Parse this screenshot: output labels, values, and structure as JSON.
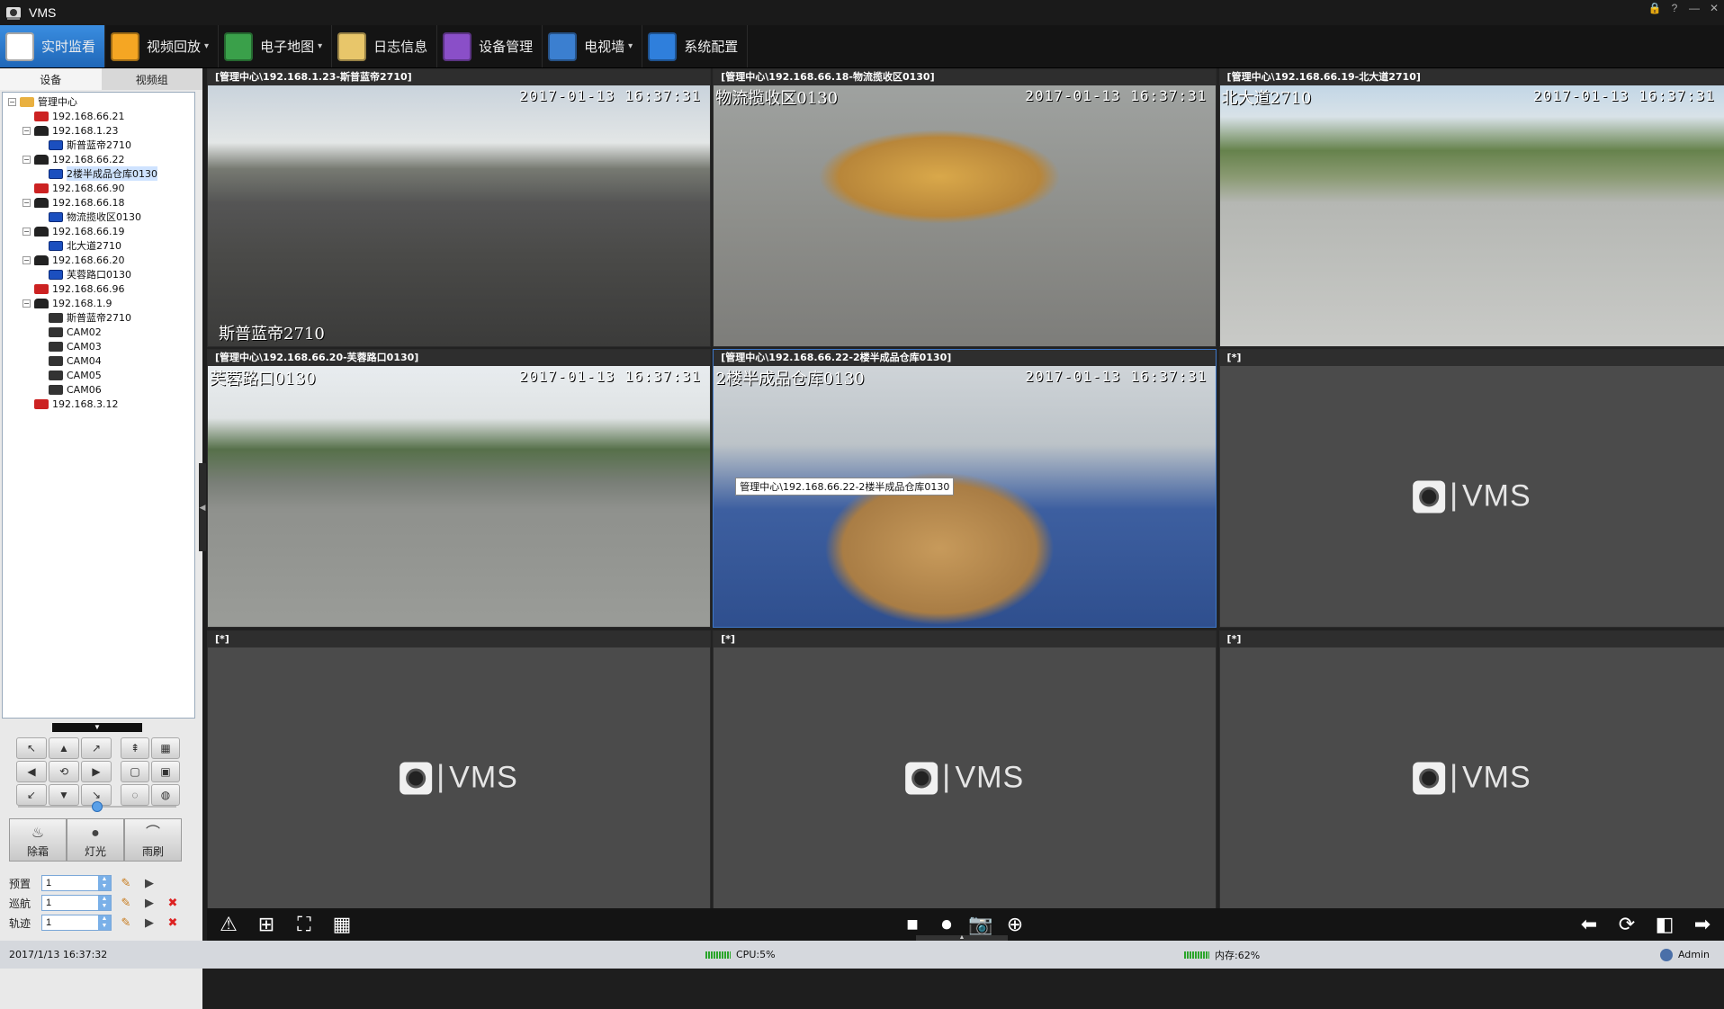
{
  "window": {
    "title": "VMS",
    "controls": [
      "🔒",
      "?",
      "—",
      "✕"
    ]
  },
  "menu": [
    {
      "label": "实时监看",
      "icon": "live-view-icon",
      "active": true,
      "caret": false,
      "color": "#ffffff"
    },
    {
      "label": "视频回放",
      "icon": "playback-icon",
      "active": false,
      "caret": true,
      "color": "#f5a623"
    },
    {
      "label": "电子地图",
      "icon": "emap-icon",
      "active": false,
      "caret": true,
      "color": "#3aa04a"
    },
    {
      "label": "日志信息",
      "icon": "log-icon",
      "active": false,
      "caret": false,
      "color": "#e8c66a"
    },
    {
      "label": "设备管理",
      "icon": "device-mgmt-icon",
      "active": false,
      "caret": false,
      "color": "#8a4fc8"
    },
    {
      "label": "电视墙",
      "icon": "tv-wall-icon",
      "active": false,
      "caret": true,
      "color": "#3b7fd0"
    },
    {
      "label": "系统配置",
      "icon": "settings-gear-icon",
      "active": false,
      "caret": false,
      "color": "#2f7fdc"
    }
  ],
  "left_tabs": [
    "设备",
    "视频组"
  ],
  "tree": [
    {
      "level": 0,
      "exp": "−",
      "icon": "root",
      "label": "管理中心"
    },
    {
      "level": 1,
      "exp": "",
      "icon": "off",
      "label": "192.168.66.21"
    },
    {
      "level": 1,
      "exp": "−",
      "icon": "nvr",
      "label": "192.168.1.23"
    },
    {
      "level": 2,
      "exp": "",
      "icon": "ipc",
      "label": "斯普蓝帝2710"
    },
    {
      "level": 1,
      "exp": "−",
      "icon": "nvr",
      "label": "192.168.66.22"
    },
    {
      "level": 2,
      "exp": "",
      "icon": "ipc",
      "label": "2楼半成品仓库0130",
      "selected": true
    },
    {
      "level": 1,
      "exp": "",
      "icon": "off",
      "label": "192.168.66.90"
    },
    {
      "level": 1,
      "exp": "−",
      "icon": "nvr",
      "label": "192.168.66.18"
    },
    {
      "level": 2,
      "exp": "",
      "icon": "ipc",
      "label": "物流揽收区0130"
    },
    {
      "level": 1,
      "exp": "−",
      "icon": "nvr",
      "label": "192.168.66.19"
    },
    {
      "level": 2,
      "exp": "",
      "icon": "ipc",
      "label": "北大道2710"
    },
    {
      "level": 1,
      "exp": "−",
      "icon": "nvr",
      "label": "192.168.66.20"
    },
    {
      "level": 2,
      "exp": "",
      "icon": "ipc",
      "label": "芙蓉路口0130"
    },
    {
      "level": 1,
      "exp": "",
      "icon": "off",
      "label": "192.168.66.96"
    },
    {
      "level": 1,
      "exp": "−",
      "icon": "nvr",
      "label": "192.168.1.9"
    },
    {
      "level": 2,
      "exp": "",
      "icon": "cam",
      "label": "斯普蓝帝2710"
    },
    {
      "level": 2,
      "exp": "",
      "icon": "cam",
      "label": "CAM02"
    },
    {
      "level": 2,
      "exp": "",
      "icon": "cam",
      "label": "CAM03"
    },
    {
      "level": 2,
      "exp": "",
      "icon": "cam",
      "label": "CAM04"
    },
    {
      "level": 2,
      "exp": "",
      "icon": "cam",
      "label": "CAM05"
    },
    {
      "level": 2,
      "exp": "",
      "icon": "cam",
      "label": "CAM06"
    },
    {
      "level": 1,
      "exp": "",
      "icon": "off",
      "label": "192.168.3.12"
    }
  ],
  "ptz": {
    "collapse": "▼",
    "directions": [
      "↖",
      "▲",
      "↗",
      "◀",
      "⟲",
      "▶",
      "↙",
      "▼",
      "↘"
    ],
    "zoom_buttons": [
      "⇞",
      "▦",
      "▢",
      "▣",
      "◌",
      "◍"
    ],
    "speed_level": 0.5,
    "functions": [
      {
        "label": "除霜",
        "icon": "defrost-icon",
        "glyph": "♨"
      },
      {
        "label": "灯光",
        "icon": "light-icon",
        "glyph": "●"
      },
      {
        "label": "雨刷",
        "icon": "wiper-icon",
        "glyph": "⌒"
      }
    ],
    "rows": [
      {
        "label": "预置",
        "value": "1",
        "actions": [
          "edit",
          "play"
        ]
      },
      {
        "label": "巡航",
        "value": "1",
        "actions": [
          "edit",
          "play",
          "del"
        ]
      },
      {
        "label": "轨迹",
        "value": "1",
        "actions": [
          "edit",
          "play",
          "del"
        ]
      }
    ]
  },
  "cells": [
    {
      "header": "[管理中心\\192.168.1.23-斯普蓝帝2710]",
      "time": "2017-01-13 16:37:31",
      "osd": "斯普蓝帝2710",
      "osd_pos": "bottom",
      "scene": "road1"
    },
    {
      "header": "[管理中心\\192.168.66.18-物流揽收区0130]",
      "time": "2017-01-13 16:37:31",
      "osd": "物流揽收区0130",
      "osd_pos": "top",
      "scene": "boxes"
    },
    {
      "header": "[管理中心\\192.168.66.19-北大道2710]",
      "time": "2017-01-13 16:37:31",
      "osd": "北大道2710",
      "osd_pos": "top",
      "scene": "road2"
    },
    {
      "header": "[管理中心\\192.168.66.20-芙蓉路口0130]",
      "time": "2017-01-13 16:37:31",
      "osd": "芙蓉路口0130",
      "osd_pos": "top",
      "scene": "road3"
    },
    {
      "header": "[管理中心\\192.168.66.22-2楼半成品仓库0130]",
      "time": "2017-01-13 16:37:31",
      "osd": "2楼半成品仓库0130",
      "osd_pos": "top",
      "scene": "warehouse",
      "focus": true,
      "tooltip": "管理中心\\192.168.66.22-2楼半成品仓库0130"
    },
    {
      "header": "[*]",
      "empty": true
    },
    {
      "header": "[*]",
      "empty": true
    },
    {
      "header": "[*]",
      "empty": true
    },
    {
      "header": "[*]",
      "empty": true
    }
  ],
  "placeholder_logo": "VMS",
  "toolbar": {
    "left": [
      {
        "name": "alarm-icon",
        "glyph": "⚠"
      },
      {
        "name": "layout-split-icon",
        "glyph": "⊞"
      },
      {
        "name": "fullscreen-icon",
        "glyph": "⛶"
      },
      {
        "name": "layout-grid-icon",
        "glyph": "▦"
      }
    ],
    "center": [
      {
        "name": "stop-all-icon",
        "glyph": "■"
      },
      {
        "name": "record-icon",
        "glyph": "⏺"
      },
      {
        "name": "snapshot-camera-icon",
        "glyph": "📷"
      },
      {
        "name": "zoom-in-icon",
        "glyph": "⊕"
      }
    ],
    "right": [
      {
        "name": "prev-page-icon",
        "glyph": "⬅"
      },
      {
        "name": "refresh-icon",
        "glyph": "⟳"
      },
      {
        "name": "window-icon",
        "glyph": "◧"
      },
      {
        "name": "next-page-icon",
        "glyph": "➡"
      }
    ]
  },
  "status": {
    "datetime": "2017/1/13 16:37:32",
    "cpu": "CPU:5%",
    "mem": "内存:62%",
    "user": "Admin"
  }
}
